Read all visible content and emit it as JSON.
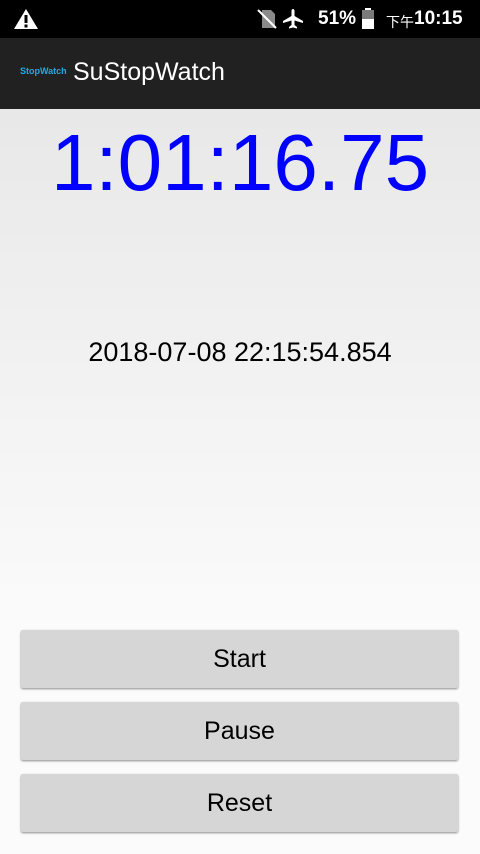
{
  "status_bar": {
    "battery_percent": "51%",
    "time_prefix": "下午",
    "time": "10:15",
    "icons": [
      "warning-icon",
      "no-sim-icon",
      "airplane-mode-icon",
      "battery-icon"
    ]
  },
  "app_bar": {
    "logo_text": "StopWatch",
    "title": "SuStopWatch"
  },
  "main": {
    "elapsed": "1:01:16.75",
    "timestamp": "2018-07-08 22:15:54.854"
  },
  "buttons": {
    "start": "Start",
    "pause": "Pause",
    "reset": "Reset"
  },
  "colors": {
    "elapsed_text": "#0000ff",
    "app_bar": "#212121",
    "logo": "#29a8e0",
    "button": "#d6d6d6"
  }
}
